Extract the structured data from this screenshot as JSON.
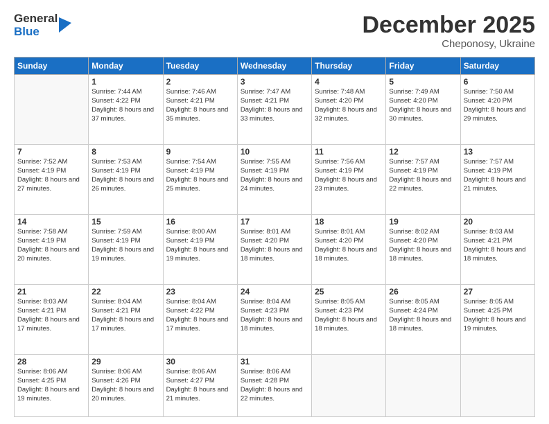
{
  "logo": {
    "general": "General",
    "blue": "Blue"
  },
  "header": {
    "month": "December 2025",
    "location": "Cheponosy, Ukraine"
  },
  "days_of_week": [
    "Sunday",
    "Monday",
    "Tuesday",
    "Wednesday",
    "Thursday",
    "Friday",
    "Saturday"
  ],
  "weeks": [
    [
      {
        "day": "",
        "empty": true
      },
      {
        "day": "1",
        "sunrise": "7:44 AM",
        "sunset": "4:22 PM",
        "daylight": "8 hours and 37 minutes."
      },
      {
        "day": "2",
        "sunrise": "7:46 AM",
        "sunset": "4:21 PM",
        "daylight": "8 hours and 35 minutes."
      },
      {
        "day": "3",
        "sunrise": "7:47 AM",
        "sunset": "4:21 PM",
        "daylight": "8 hours and 33 minutes."
      },
      {
        "day": "4",
        "sunrise": "7:48 AM",
        "sunset": "4:20 PM",
        "daylight": "8 hours and 32 minutes."
      },
      {
        "day": "5",
        "sunrise": "7:49 AM",
        "sunset": "4:20 PM",
        "daylight": "8 hours and 30 minutes."
      },
      {
        "day": "6",
        "sunrise": "7:50 AM",
        "sunset": "4:20 PM",
        "daylight": "8 hours and 29 minutes."
      }
    ],
    [
      {
        "day": "7",
        "sunrise": "7:52 AM",
        "sunset": "4:19 PM",
        "daylight": "8 hours and 27 minutes."
      },
      {
        "day": "8",
        "sunrise": "7:53 AM",
        "sunset": "4:19 PM",
        "daylight": "8 hours and 26 minutes."
      },
      {
        "day": "9",
        "sunrise": "7:54 AM",
        "sunset": "4:19 PM",
        "daylight": "8 hours and 25 minutes."
      },
      {
        "day": "10",
        "sunrise": "7:55 AM",
        "sunset": "4:19 PM",
        "daylight": "8 hours and 24 minutes."
      },
      {
        "day": "11",
        "sunrise": "7:56 AM",
        "sunset": "4:19 PM",
        "daylight": "8 hours and 23 minutes."
      },
      {
        "day": "12",
        "sunrise": "7:57 AM",
        "sunset": "4:19 PM",
        "daylight": "8 hours and 22 minutes."
      },
      {
        "day": "13",
        "sunrise": "7:57 AM",
        "sunset": "4:19 PM",
        "daylight": "8 hours and 21 minutes."
      }
    ],
    [
      {
        "day": "14",
        "sunrise": "7:58 AM",
        "sunset": "4:19 PM",
        "daylight": "8 hours and 20 minutes."
      },
      {
        "day": "15",
        "sunrise": "7:59 AM",
        "sunset": "4:19 PM",
        "daylight": "8 hours and 19 minutes."
      },
      {
        "day": "16",
        "sunrise": "8:00 AM",
        "sunset": "4:19 PM",
        "daylight": "8 hours and 19 minutes."
      },
      {
        "day": "17",
        "sunrise": "8:01 AM",
        "sunset": "4:20 PM",
        "daylight": "8 hours and 18 minutes."
      },
      {
        "day": "18",
        "sunrise": "8:01 AM",
        "sunset": "4:20 PM",
        "daylight": "8 hours and 18 minutes."
      },
      {
        "day": "19",
        "sunrise": "8:02 AM",
        "sunset": "4:20 PM",
        "daylight": "8 hours and 18 minutes."
      },
      {
        "day": "20",
        "sunrise": "8:03 AM",
        "sunset": "4:21 PM",
        "daylight": "8 hours and 18 minutes."
      }
    ],
    [
      {
        "day": "21",
        "sunrise": "8:03 AM",
        "sunset": "4:21 PM",
        "daylight": "8 hours and 17 minutes."
      },
      {
        "day": "22",
        "sunrise": "8:04 AM",
        "sunset": "4:21 PM",
        "daylight": "8 hours and 17 minutes."
      },
      {
        "day": "23",
        "sunrise": "8:04 AM",
        "sunset": "4:22 PM",
        "daylight": "8 hours and 17 minutes."
      },
      {
        "day": "24",
        "sunrise": "8:04 AM",
        "sunset": "4:23 PM",
        "daylight": "8 hours and 18 minutes."
      },
      {
        "day": "25",
        "sunrise": "8:05 AM",
        "sunset": "4:23 PM",
        "daylight": "8 hours and 18 minutes."
      },
      {
        "day": "26",
        "sunrise": "8:05 AM",
        "sunset": "4:24 PM",
        "daylight": "8 hours and 18 minutes."
      },
      {
        "day": "27",
        "sunrise": "8:05 AM",
        "sunset": "4:25 PM",
        "daylight": "8 hours and 19 minutes."
      }
    ],
    [
      {
        "day": "28",
        "sunrise": "8:06 AM",
        "sunset": "4:25 PM",
        "daylight": "8 hours and 19 minutes."
      },
      {
        "day": "29",
        "sunrise": "8:06 AM",
        "sunset": "4:26 PM",
        "daylight": "8 hours and 20 minutes."
      },
      {
        "day": "30",
        "sunrise": "8:06 AM",
        "sunset": "4:27 PM",
        "daylight": "8 hours and 21 minutes."
      },
      {
        "day": "31",
        "sunrise": "8:06 AM",
        "sunset": "4:28 PM",
        "daylight": "8 hours and 22 minutes."
      },
      {
        "day": "",
        "empty": true
      },
      {
        "day": "",
        "empty": true
      },
      {
        "day": "",
        "empty": true
      }
    ]
  ]
}
